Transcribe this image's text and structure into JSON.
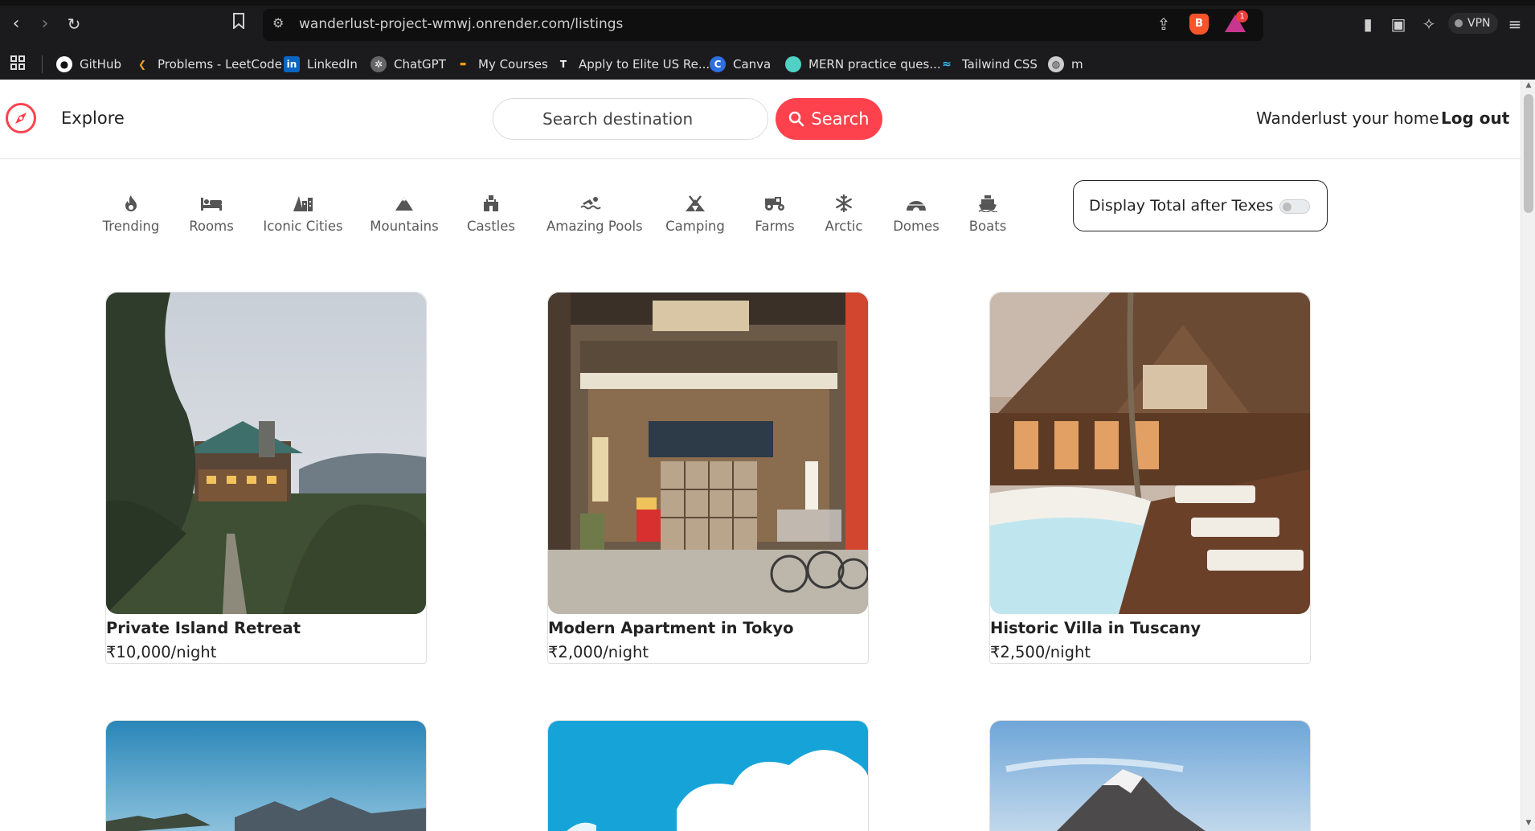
{
  "browser": {
    "url": "wanderlust-project-wmwj.onrender.com/listings",
    "rewards_badge": "1",
    "vpn_label": "VPN"
  },
  "bookmarks": [
    {
      "label": "GitHub",
      "icon": "github-icon"
    },
    {
      "label": "Problems - LeetCode",
      "icon": "leetcode-icon"
    },
    {
      "label": "LinkedIn",
      "icon": "linkedin-icon"
    },
    {
      "label": "ChatGPT",
      "icon": "chatgpt-icon"
    },
    {
      "label": "My Courses",
      "icon": "courses-icon"
    },
    {
      "label": "Apply to Elite US Re...",
      "icon": "turing-icon"
    },
    {
      "label": "Canva",
      "icon": "canva-icon"
    },
    {
      "label": "MERN practice ques...",
      "icon": "mern-icon"
    },
    {
      "label": "Tailwind CSS",
      "icon": "tailwind-icon"
    },
    {
      "label": "m",
      "icon": "globe-icon"
    }
  ],
  "navbar": {
    "explore": "Explore",
    "search_placeholder": "Search destination",
    "search_button": "Search",
    "home_link": "Wanderlust your home",
    "logout": "Log out",
    "accent": "#fe424d"
  },
  "filters": [
    {
      "label": "Trending",
      "icon": "fire-icon"
    },
    {
      "label": "Rooms",
      "icon": "bed-icon"
    },
    {
      "label": "Iconic Cities",
      "icon": "city-icon"
    },
    {
      "label": "Mountains",
      "icon": "mountain-icon"
    },
    {
      "label": "Castles",
      "icon": "castle-icon"
    },
    {
      "label": "Amazing Pools",
      "icon": "pool-icon"
    },
    {
      "label": "Camping",
      "icon": "campground-icon"
    },
    {
      "label": "Farms",
      "icon": "tractor-icon"
    },
    {
      "label": "Arctic",
      "icon": "snowflake-icon"
    },
    {
      "label": "Domes",
      "icon": "igloo-icon"
    },
    {
      "label": "Boats",
      "icon": "ship-icon"
    }
  ],
  "tax_toggle": {
    "label": "Display Total after Texes",
    "on": false
  },
  "listings": [
    {
      "title": "Private Island Retreat",
      "price": "₹10,000/night"
    },
    {
      "title": "Modern Apartment in Tokyo",
      "price": "₹2,000/night"
    },
    {
      "title": "Historic Villa in Tuscany",
      "price": "₹2,500/night"
    }
  ]
}
